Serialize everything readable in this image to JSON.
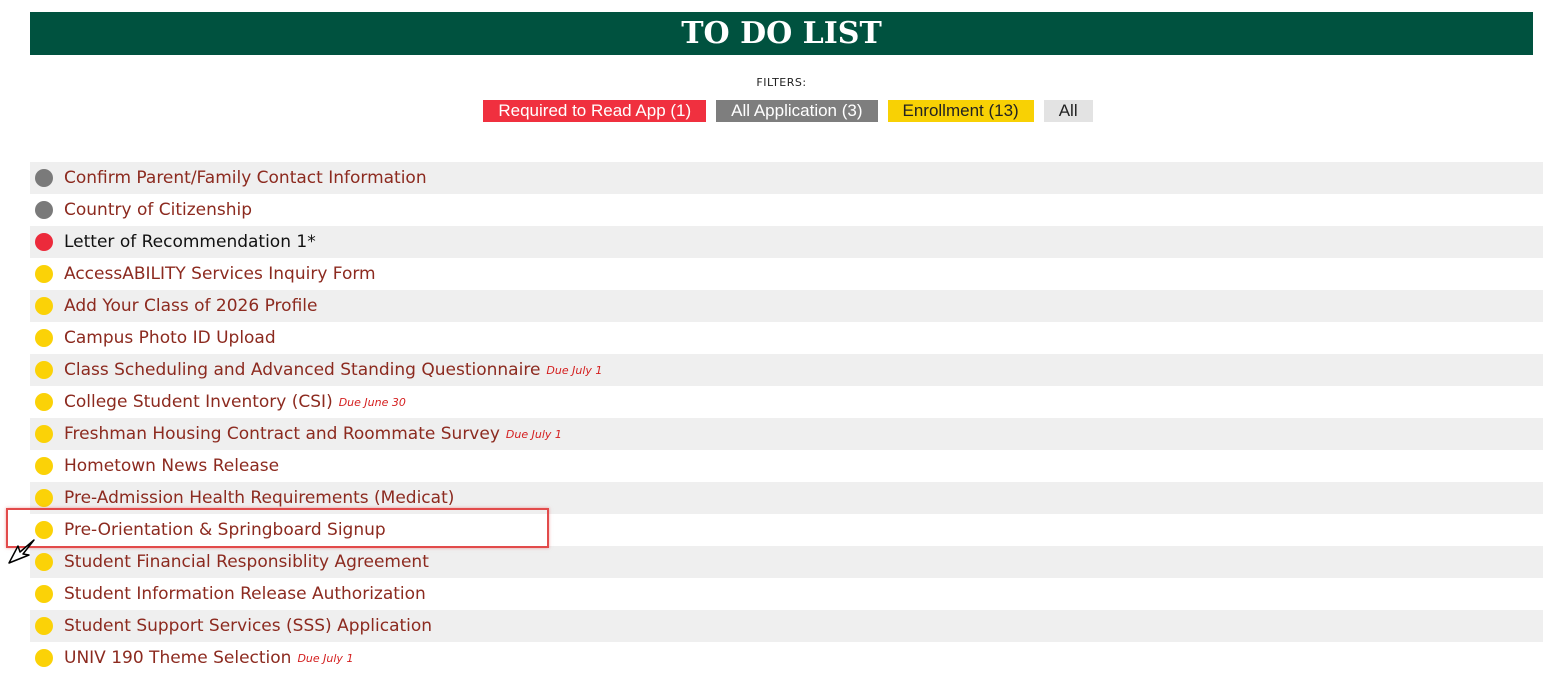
{
  "header": {
    "title": "TO DO LIST"
  },
  "filters": {
    "label": "FILTERS:",
    "buttons": [
      {
        "label": "Required to Read App (1)",
        "color": "#f0303f"
      },
      {
        "label": "All Application (3)",
        "color": "#7e7e7e"
      },
      {
        "label": "Enrollment (13)",
        "color": "#f8d104"
      },
      {
        "label": "All",
        "color": "#e3e3e3"
      }
    ]
  },
  "todo": {
    "items": [
      {
        "label": "Confirm Parent/Family Contact Information",
        "status": "gray",
        "due": ""
      },
      {
        "label": "Country of Citizenship",
        "status": "gray",
        "due": ""
      },
      {
        "label": "Letter of Recommendation 1*",
        "status": "red",
        "due": ""
      },
      {
        "label": "AccessABILITY Services Inquiry Form",
        "status": "yellow",
        "due": ""
      },
      {
        "label": "Add Your Class of 2026 Profile",
        "status": "yellow",
        "due": ""
      },
      {
        "label": "Campus Photo ID Upload",
        "status": "yellow",
        "due": ""
      },
      {
        "label": "Class Scheduling and Advanced Standing Questionnaire",
        "status": "yellow",
        "due": "Due July 1"
      },
      {
        "label": "College Student Inventory (CSI)",
        "status": "yellow",
        "due": "Due June 30"
      },
      {
        "label": "Freshman Housing Contract and Roommate Survey",
        "status": "yellow",
        "due": "Due July 1"
      },
      {
        "label": "Hometown News Release",
        "status": "yellow",
        "due": ""
      },
      {
        "label": "Pre-Admission Health Requirements (Medicat)",
        "status": "yellow",
        "due": ""
      },
      {
        "label": "Pre-Orientation & Springboard Signup",
        "status": "yellow",
        "due": ""
      },
      {
        "label": "Student Financial Responsiblity Agreement",
        "status": "yellow",
        "due": ""
      },
      {
        "label": "Student Information Release Authorization",
        "status": "yellow",
        "due": ""
      },
      {
        "label": "Student Support Services (SSS) Application",
        "status": "yellow",
        "due": ""
      },
      {
        "label": "UNIV 190 Theme Selection",
        "status": "yellow",
        "due": "Due July 1"
      }
    ]
  },
  "colors": {
    "header_bg": "#00523f",
    "link": "#8c2a1f",
    "due": "#d41f1f",
    "status_gray": "#7a7a7a",
    "status_red": "#ec2a3b",
    "status_yellow": "#fbd207",
    "highlight": "#e24b4b"
  },
  "icons": {
    "cursor": "mouse-pointer-icon"
  }
}
